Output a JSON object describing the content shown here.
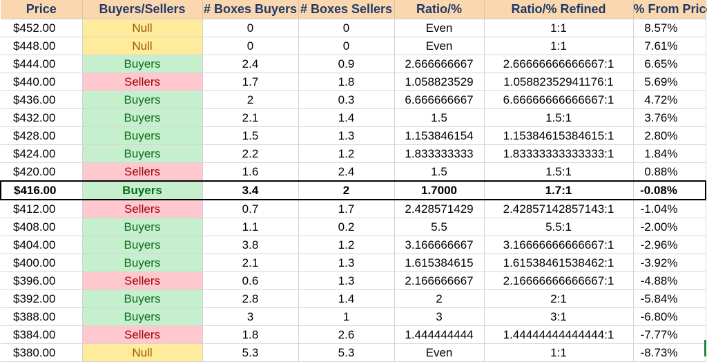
{
  "headers": [
    "Price",
    "Buyers/Sellers",
    "# Boxes Buyers",
    "# Boxes Sellers",
    "Ratio/%",
    "Ratio/% Refined",
    "% From Price"
  ],
  "rows": [
    {
      "price": "$452.00",
      "side": "Null",
      "boxes_buyers": "0",
      "boxes_sellers": "0",
      "ratio": "Even",
      "ratio_refined": "1:1",
      "from_price": "8.57%"
    },
    {
      "price": "$448.00",
      "side": "Null",
      "boxes_buyers": "0",
      "boxes_sellers": "0",
      "ratio": "Even",
      "ratio_refined": "1:1",
      "from_price": "7.61%"
    },
    {
      "price": "$444.00",
      "side": "Buyers",
      "boxes_buyers": "2.4",
      "boxes_sellers": "0.9",
      "ratio": "2.666666667",
      "ratio_refined": "2.66666666666667:1",
      "from_price": "6.65%"
    },
    {
      "price": "$440.00",
      "side": "Sellers",
      "boxes_buyers": "1.7",
      "boxes_sellers": "1.8",
      "ratio": "1.058823529",
      "ratio_refined": "1.05882352941176:1",
      "from_price": "5.69%"
    },
    {
      "price": "$436.00",
      "side": "Buyers",
      "boxes_buyers": "2",
      "boxes_sellers": "0.3",
      "ratio": "6.666666667",
      "ratio_refined": "6.66666666666667:1",
      "from_price": "4.72%"
    },
    {
      "price": "$432.00",
      "side": "Buyers",
      "boxes_buyers": "2.1",
      "boxes_sellers": "1.4",
      "ratio": "1.5",
      "ratio_refined": "1.5:1",
      "from_price": "3.76%"
    },
    {
      "price": "$428.00",
      "side": "Buyers",
      "boxes_buyers": "1.5",
      "boxes_sellers": "1.3",
      "ratio": "1.153846154",
      "ratio_refined": "1.15384615384615:1",
      "from_price": "2.80%"
    },
    {
      "price": "$424.00",
      "side": "Buyers",
      "boxes_buyers": "2.2",
      "boxes_sellers": "1.2",
      "ratio": "1.833333333",
      "ratio_refined": "1.83333333333333:1",
      "from_price": "1.84%"
    },
    {
      "price": "$420.00",
      "side": "Sellers",
      "boxes_buyers": "1.6",
      "boxes_sellers": "2.4",
      "ratio": "1.5",
      "ratio_refined": "1.5:1",
      "from_price": "0.88%"
    },
    {
      "price": "$416.00",
      "side": "Buyers",
      "boxes_buyers": "3.4",
      "boxes_sellers": "2",
      "ratio": "1.7000",
      "ratio_refined": "1.7:1",
      "from_price": "-0.08%",
      "current": true
    },
    {
      "price": "$412.00",
      "side": "Sellers",
      "boxes_buyers": "0.7",
      "boxes_sellers": "1.7",
      "ratio": "2.428571429",
      "ratio_refined": "2.42857142857143:1",
      "from_price": "-1.04%"
    },
    {
      "price": "$408.00",
      "side": "Buyers",
      "boxes_buyers": "1.1",
      "boxes_sellers": "0.2",
      "ratio": "5.5",
      "ratio_refined": "5.5:1",
      "from_price": "-2.00%"
    },
    {
      "price": "$404.00",
      "side": "Buyers",
      "boxes_buyers": "3.8",
      "boxes_sellers": "1.2",
      "ratio": "3.166666667",
      "ratio_refined": "3.16666666666667:1",
      "from_price": "-2.96%"
    },
    {
      "price": "$400.00",
      "side": "Buyers",
      "boxes_buyers": "2.1",
      "boxes_sellers": "1.3",
      "ratio": "1.615384615",
      "ratio_refined": "1.61538461538462:1",
      "from_price": "-3.92%"
    },
    {
      "price": "$396.00",
      "side": "Sellers",
      "boxes_buyers": "0.6",
      "boxes_sellers": "1.3",
      "ratio": "2.166666667",
      "ratio_refined": "2.16666666666667:1",
      "from_price": "-4.88%"
    },
    {
      "price": "$392.00",
      "side": "Buyers",
      "boxes_buyers": "2.8",
      "boxes_sellers": "1.4",
      "ratio": "2",
      "ratio_refined": "2:1",
      "from_price": "-5.84%"
    },
    {
      "price": "$388.00",
      "side": "Buyers",
      "boxes_buyers": "3",
      "boxes_sellers": "1",
      "ratio": "3",
      "ratio_refined": "3:1",
      "from_price": "-6.80%"
    },
    {
      "price": "$384.00",
      "side": "Sellers",
      "boxes_buyers": "1.8",
      "boxes_sellers": "2.6",
      "ratio": "1.444444444",
      "ratio_refined": "1.44444444444444:1",
      "from_price": "-7.77%"
    },
    {
      "price": "$380.00",
      "side": "Null",
      "boxes_buyers": "5.3",
      "boxes_sellers": "5.3",
      "ratio": "Even",
      "ratio_refined": "1:1",
      "from_price": "-8.73%"
    }
  ],
  "colors": {
    "header_bg": "#fbd7b0",
    "header_text": "#1e3a66",
    "buyers_bg": "#c6efce",
    "buyers_text": "#0b6e1a",
    "sellers_bg": "#ffc7ce",
    "sellers_text": "#9c0006",
    "null_bg": "#ffeb9c",
    "null_text": "#9c5700"
  }
}
